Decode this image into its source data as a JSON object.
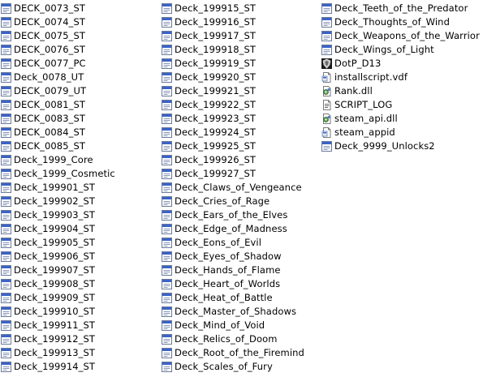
{
  "columns": [
    {
      "items": [
        {
          "label": "DECK_0073_ST",
          "icon": "exe-window-icon"
        },
        {
          "label": "DECK_0074_ST",
          "icon": "exe-window-icon"
        },
        {
          "label": "DECK_0075_ST",
          "icon": "exe-window-icon"
        },
        {
          "label": "DECK_0076_ST",
          "icon": "exe-window-icon"
        },
        {
          "label": "DECK_0077_PC",
          "icon": "exe-window-icon"
        },
        {
          "label": "Deck_0078_UT",
          "icon": "exe-window-icon"
        },
        {
          "label": "DECK_0079_UT",
          "icon": "exe-window-icon"
        },
        {
          "label": "DECK_0081_ST",
          "icon": "exe-window-icon"
        },
        {
          "label": "DECK_0083_ST",
          "icon": "exe-window-icon"
        },
        {
          "label": "DECK_0084_ST",
          "icon": "exe-window-icon"
        },
        {
          "label": "DECK_0085_ST",
          "icon": "exe-window-icon"
        },
        {
          "label": "Deck_1999_Core",
          "icon": "exe-window-icon"
        },
        {
          "label": "Deck_1999_Cosmetic",
          "icon": "exe-window-icon"
        },
        {
          "label": "Deck_199901_ST",
          "icon": "exe-window-icon"
        },
        {
          "label": "Deck_199902_ST",
          "icon": "exe-window-icon"
        },
        {
          "label": "Deck_199903_ST",
          "icon": "exe-window-icon"
        },
        {
          "label": "Deck_199904_ST",
          "icon": "exe-window-icon"
        },
        {
          "label": "Deck_199905_ST",
          "icon": "exe-window-icon"
        },
        {
          "label": "Deck_199906_ST",
          "icon": "exe-window-icon"
        },
        {
          "label": "Deck_199907_ST",
          "icon": "exe-window-icon"
        },
        {
          "label": "Deck_199908_ST",
          "icon": "exe-window-icon"
        },
        {
          "label": "Deck_199909_ST",
          "icon": "exe-window-icon"
        },
        {
          "label": "Deck_199910_ST",
          "icon": "exe-window-icon"
        },
        {
          "label": "Deck_199911_ST",
          "icon": "exe-window-icon"
        },
        {
          "label": "Deck_199912_ST",
          "icon": "exe-window-icon"
        },
        {
          "label": "Deck_199913_ST",
          "icon": "exe-window-icon"
        },
        {
          "label": "Deck_199914_ST",
          "icon": "exe-window-icon"
        }
      ]
    },
    {
      "items": [
        {
          "label": "Deck_199915_ST",
          "icon": "exe-window-icon"
        },
        {
          "label": "Deck_199916_ST",
          "icon": "exe-window-icon"
        },
        {
          "label": "Deck_199917_ST",
          "icon": "exe-window-icon"
        },
        {
          "label": "Deck_199918_ST",
          "icon": "exe-window-icon"
        },
        {
          "label": "Deck_199919_ST",
          "icon": "exe-window-icon"
        },
        {
          "label": "Deck_199920_ST",
          "icon": "exe-window-icon"
        },
        {
          "label": "Deck_199921_ST",
          "icon": "exe-window-icon"
        },
        {
          "label": "Deck_199922_ST",
          "icon": "exe-window-icon"
        },
        {
          "label": "Deck_199923_ST",
          "icon": "exe-window-icon"
        },
        {
          "label": "Deck_199924_ST",
          "icon": "exe-window-icon"
        },
        {
          "label": "Deck_199925_ST",
          "icon": "exe-window-icon"
        },
        {
          "label": "Deck_199926_ST",
          "icon": "exe-window-icon"
        },
        {
          "label": "Deck_199927_ST",
          "icon": "exe-window-icon"
        },
        {
          "label": "Deck_Claws_of_Vengeance",
          "icon": "exe-window-icon"
        },
        {
          "label": "Deck_Cries_of_Rage",
          "icon": "exe-window-icon"
        },
        {
          "label": "Deck_Ears_of_the_Elves",
          "icon": "exe-window-icon"
        },
        {
          "label": "Deck_Edge_of_Madness",
          "icon": "exe-window-icon"
        },
        {
          "label": "Deck_Eons_of_Evil",
          "icon": "exe-window-icon"
        },
        {
          "label": "Deck_Eyes_of_Shadow",
          "icon": "exe-window-icon"
        },
        {
          "label": "Deck_Hands_of_Flame",
          "icon": "exe-window-icon"
        },
        {
          "label": "Deck_Heart_of_Worlds",
          "icon": "exe-window-icon"
        },
        {
          "label": "Deck_Heat_of_Battle",
          "icon": "exe-window-icon"
        },
        {
          "label": "Deck_Master_of_Shadows",
          "icon": "exe-window-icon"
        },
        {
          "label": "Deck_Mind_of_Void",
          "icon": "exe-window-icon"
        },
        {
          "label": "Deck_Relics_of_Doom",
          "icon": "exe-window-icon"
        },
        {
          "label": "Deck_Root_of_the_Firemind",
          "icon": "exe-window-icon"
        },
        {
          "label": "Deck_Scales_of_Fury",
          "icon": "exe-window-icon"
        }
      ]
    },
    {
      "items": [
        {
          "label": "Deck_Teeth_of_the_Predator",
          "icon": "exe-window-icon"
        },
        {
          "label": "Deck_Thoughts_of_Wind",
          "icon": "exe-window-icon"
        },
        {
          "label": "Deck_Weapons_of_the_Warrior",
          "icon": "exe-window-icon"
        },
        {
          "label": "Deck_Wings_of_Light",
          "icon": "exe-window-icon"
        },
        {
          "label": "DotP_D13",
          "icon": "game-shield-icon"
        },
        {
          "label": "installscript.vdf",
          "icon": "generic-file-icon"
        },
        {
          "label": "Rank.dll",
          "icon": "dll-gear-icon"
        },
        {
          "label": "SCRIPT_LOG",
          "icon": "text-document-icon"
        },
        {
          "label": "steam_api.dll",
          "icon": "dll-gear-icon"
        },
        {
          "label": "steam_appid",
          "icon": "generic-file-icon"
        },
        {
          "label": "Deck_9999_Unlocks2",
          "icon": "exe-window-icon"
        }
      ]
    }
  ]
}
